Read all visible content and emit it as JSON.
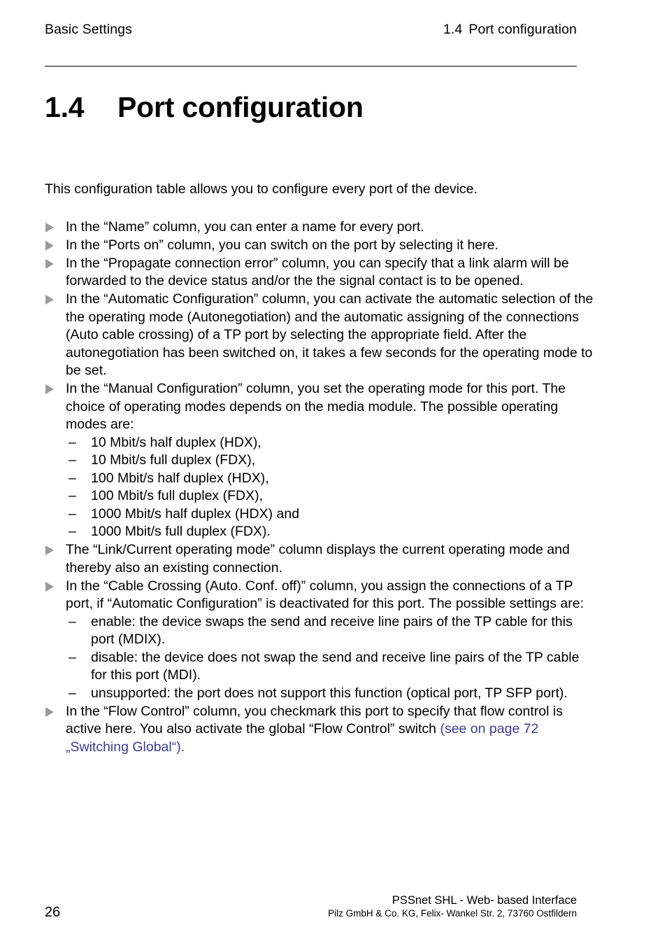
{
  "header": {
    "left_title": "Basic Settings",
    "right_section_number": "1.4",
    "right_section_title": "Port configuration"
  },
  "chapter": {
    "number": "1.4",
    "title": "Port configuration"
  },
  "lead_paragraph": "This configuration table allows you to configure every port of the device.",
  "bullets": [
    {
      "text": "In the “Name” column, you can enter a name for every port."
    },
    {
      "text": "In the “Ports on” column, you can switch on the port by selecting it here."
    },
    {
      "text": "In the “Propagate connection error” column, you can specify that a link alarm will be forwarded to the device status and/or the the signal contact is to be opened."
    },
    {
      "text": "In the “Automatic Configuration” column, you can activate the automatic selection of the the operating mode (Autonegotiation) and the automatic assigning of the connections (Auto cable crossing) of a TP port by selecting the appropriate field. After the autonegotiation has been switched on, it takes a few seconds for the operating mode to be set."
    },
    {
      "text": "In the “Manual Configuration” column, you set the operating mode for this port. The choice of operating modes depends on the media module. The possible operating modes are:",
      "sub_items": [
        "10 Mbit/s half duplex (HDX),",
        "10 Mbit/s full duplex (FDX),",
        "100 Mbit/s half duplex (HDX),",
        "100 Mbit/s full duplex (FDX),",
        "1000 Mbit/s half duplex (HDX) and",
        "1000 Mbit/s full duplex (FDX)."
      ]
    },
    {
      "text": "The “Link/Current operating mode” column displays the current operating mode and thereby also an existing connection."
    },
    {
      "text": "In the “Cable Crossing (Auto. Conf. off)” column, you assign the connections of a TP port, if “Automatic Configuration” is deactivated for this port. The possible settings are:",
      "sub_items": [
        "enable: the device swaps the send and receive line pairs of the TP cable for this port (MDIX).",
        "disable: the device does not swap the send and receive line pairs of the TP cable for this port (MDI).",
        "unsupported: the port does not support this function (optical port, TP SFP port)."
      ]
    },
    {
      "text": "In the “Flow Control” column, you checkmark this port to specify that flow control is active here. You also activate the global “Flow Control” switch ",
      "xref": "(see on page 72 „Switching Global“)."
    }
  ],
  "dash_marker": "–",
  "footer": {
    "page_number": "26",
    "product_line": "PSSnet SHL - Web- based Interface",
    "company_line": "Pilz GmbH & Co. KG, Felix- Wankel Str. 2, 73760 Ostfildern"
  },
  "colors": {
    "text": "#000000",
    "bullet_marker": "#9a9a9a",
    "cross_reference": "#3c3c96",
    "rule": "#000000"
  }
}
